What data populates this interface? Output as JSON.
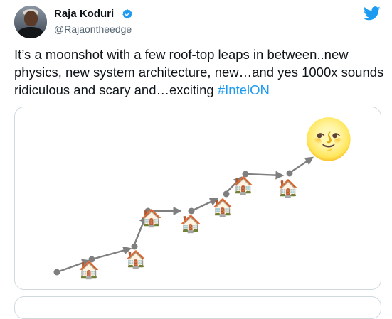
{
  "author": {
    "name": "Raja Koduri",
    "handle": "@Rajaontheedge",
    "verified": true
  },
  "tweet": {
    "text_main": "It’s a moonshot with a few roof-top leaps in between..new physics, new system architecture, new…and yes 1000x sounds ridiculous and scary and…exciting ",
    "hashtag": "#IntelON"
  },
  "icons": {
    "verified_badge": "verified-badge-icon",
    "twitter_bird": "twitter-bird-icon",
    "house": "house-emoji",
    "moon": "full-moon-face-emoji"
  },
  "colors": {
    "hashtag": "#1d9bf0",
    "verified": "#1d9bf0",
    "bird": "#1d9bf0",
    "arrow": "#7f7f7f",
    "handle": "#536471",
    "border": "#cfd9de"
  },
  "illustration": {
    "house_count": 7,
    "emoji_house": "🏠",
    "emoji_moon": "🌝"
  }
}
